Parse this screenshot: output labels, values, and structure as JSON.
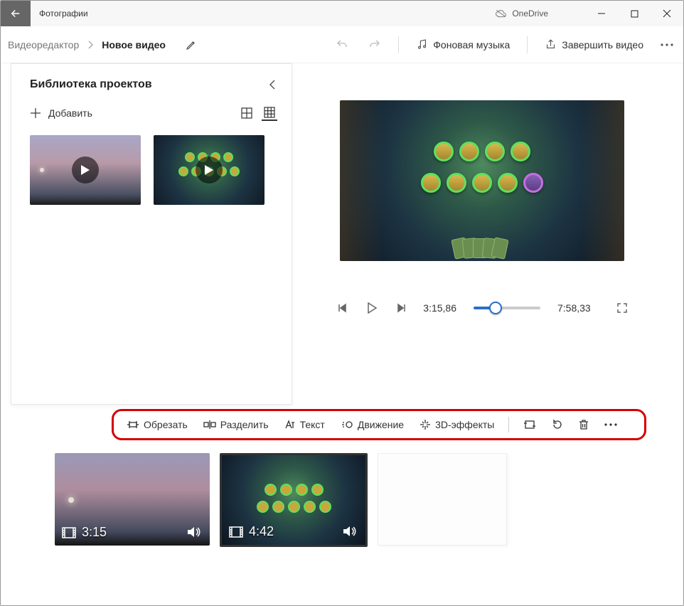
{
  "titlebar": {
    "app_name": "Фотографии",
    "onedrive_label": "OneDrive"
  },
  "commandbar": {
    "breadcrumb_root": "Видеоредактор",
    "project_title": "Новое видео",
    "music_label": "Фоновая музыка",
    "finish_label": "Завершить видео"
  },
  "library": {
    "title": "Библиотека проектов",
    "add_label": "Добавить"
  },
  "player": {
    "current_time": "3:15,86",
    "total_time": "7:58,33"
  },
  "edit_toolbar": {
    "trim": "Обрезать",
    "split": "Разделить",
    "text": "Текст",
    "motion": "Движение",
    "effects3d": "3D-эффекты"
  },
  "clips": [
    {
      "duration": "3:15"
    },
    {
      "duration": "4:42"
    }
  ]
}
